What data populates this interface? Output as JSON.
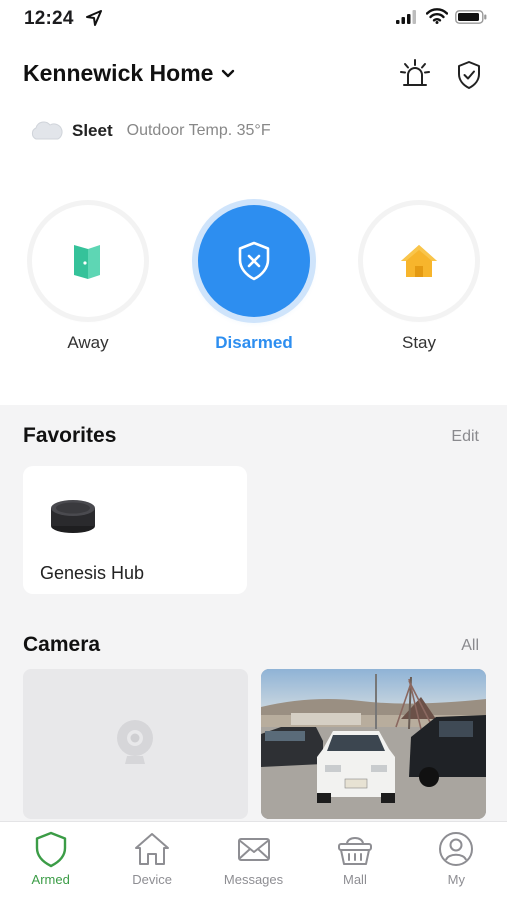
{
  "status_bar": {
    "time": "12:24"
  },
  "header": {
    "home_name": "Kennewick Home"
  },
  "weather": {
    "condition": "Sleet",
    "outdoor_temp": "Outdoor Temp. 35°F"
  },
  "modes": [
    {
      "label": "Away",
      "icon": "door-icon",
      "active": false
    },
    {
      "label": "Disarmed",
      "icon": "shield-x-icon",
      "active": true
    },
    {
      "label": "Stay",
      "icon": "house-icon",
      "active": false
    }
  ],
  "favorites": {
    "title": "Favorites",
    "edit_label": "Edit",
    "items": [
      {
        "name": "Genesis Hub",
        "icon": "hub-icon"
      }
    ]
  },
  "camera": {
    "title": "Camera",
    "all_label": "All"
  },
  "tabs": [
    {
      "label": "Armed",
      "icon": "shield-icon",
      "active": true
    },
    {
      "label": "Device",
      "icon": "house-outline-icon",
      "active": false
    },
    {
      "label": "Messages",
      "icon": "envelope-icon",
      "active": false
    },
    {
      "label": "Mall",
      "icon": "basket-icon",
      "active": false
    },
    {
      "label": "My",
      "icon": "user-icon",
      "active": false
    }
  ],
  "colors": {
    "accent_blue": "#2d8ef0",
    "active_green": "#3b9c46",
    "away_green": "#3ec9a2",
    "stay_yellow": "#f7b52c"
  }
}
